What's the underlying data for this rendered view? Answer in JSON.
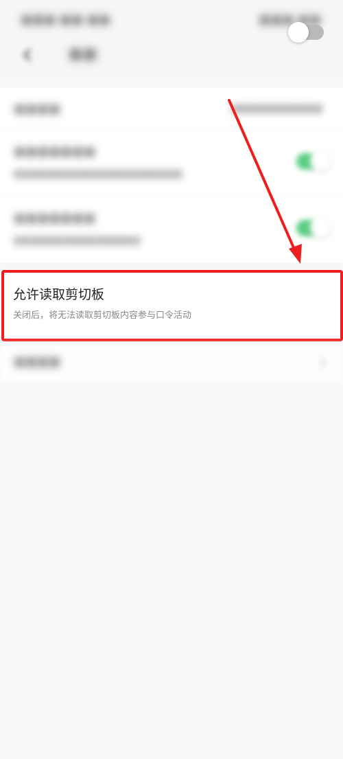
{
  "clipboard": {
    "title": "允许读取剪切板",
    "subtitle": "关闭后，将无法读取剪切板内容参与口令活动",
    "enabled": false
  },
  "colors": {
    "accent_green": "#3ec56d",
    "highlight_red": "#ee1e1e",
    "switch_off": "#b9b9b9"
  },
  "icons": {
    "back": "back-arrow-icon",
    "chevron": "chevron-right-icon"
  }
}
